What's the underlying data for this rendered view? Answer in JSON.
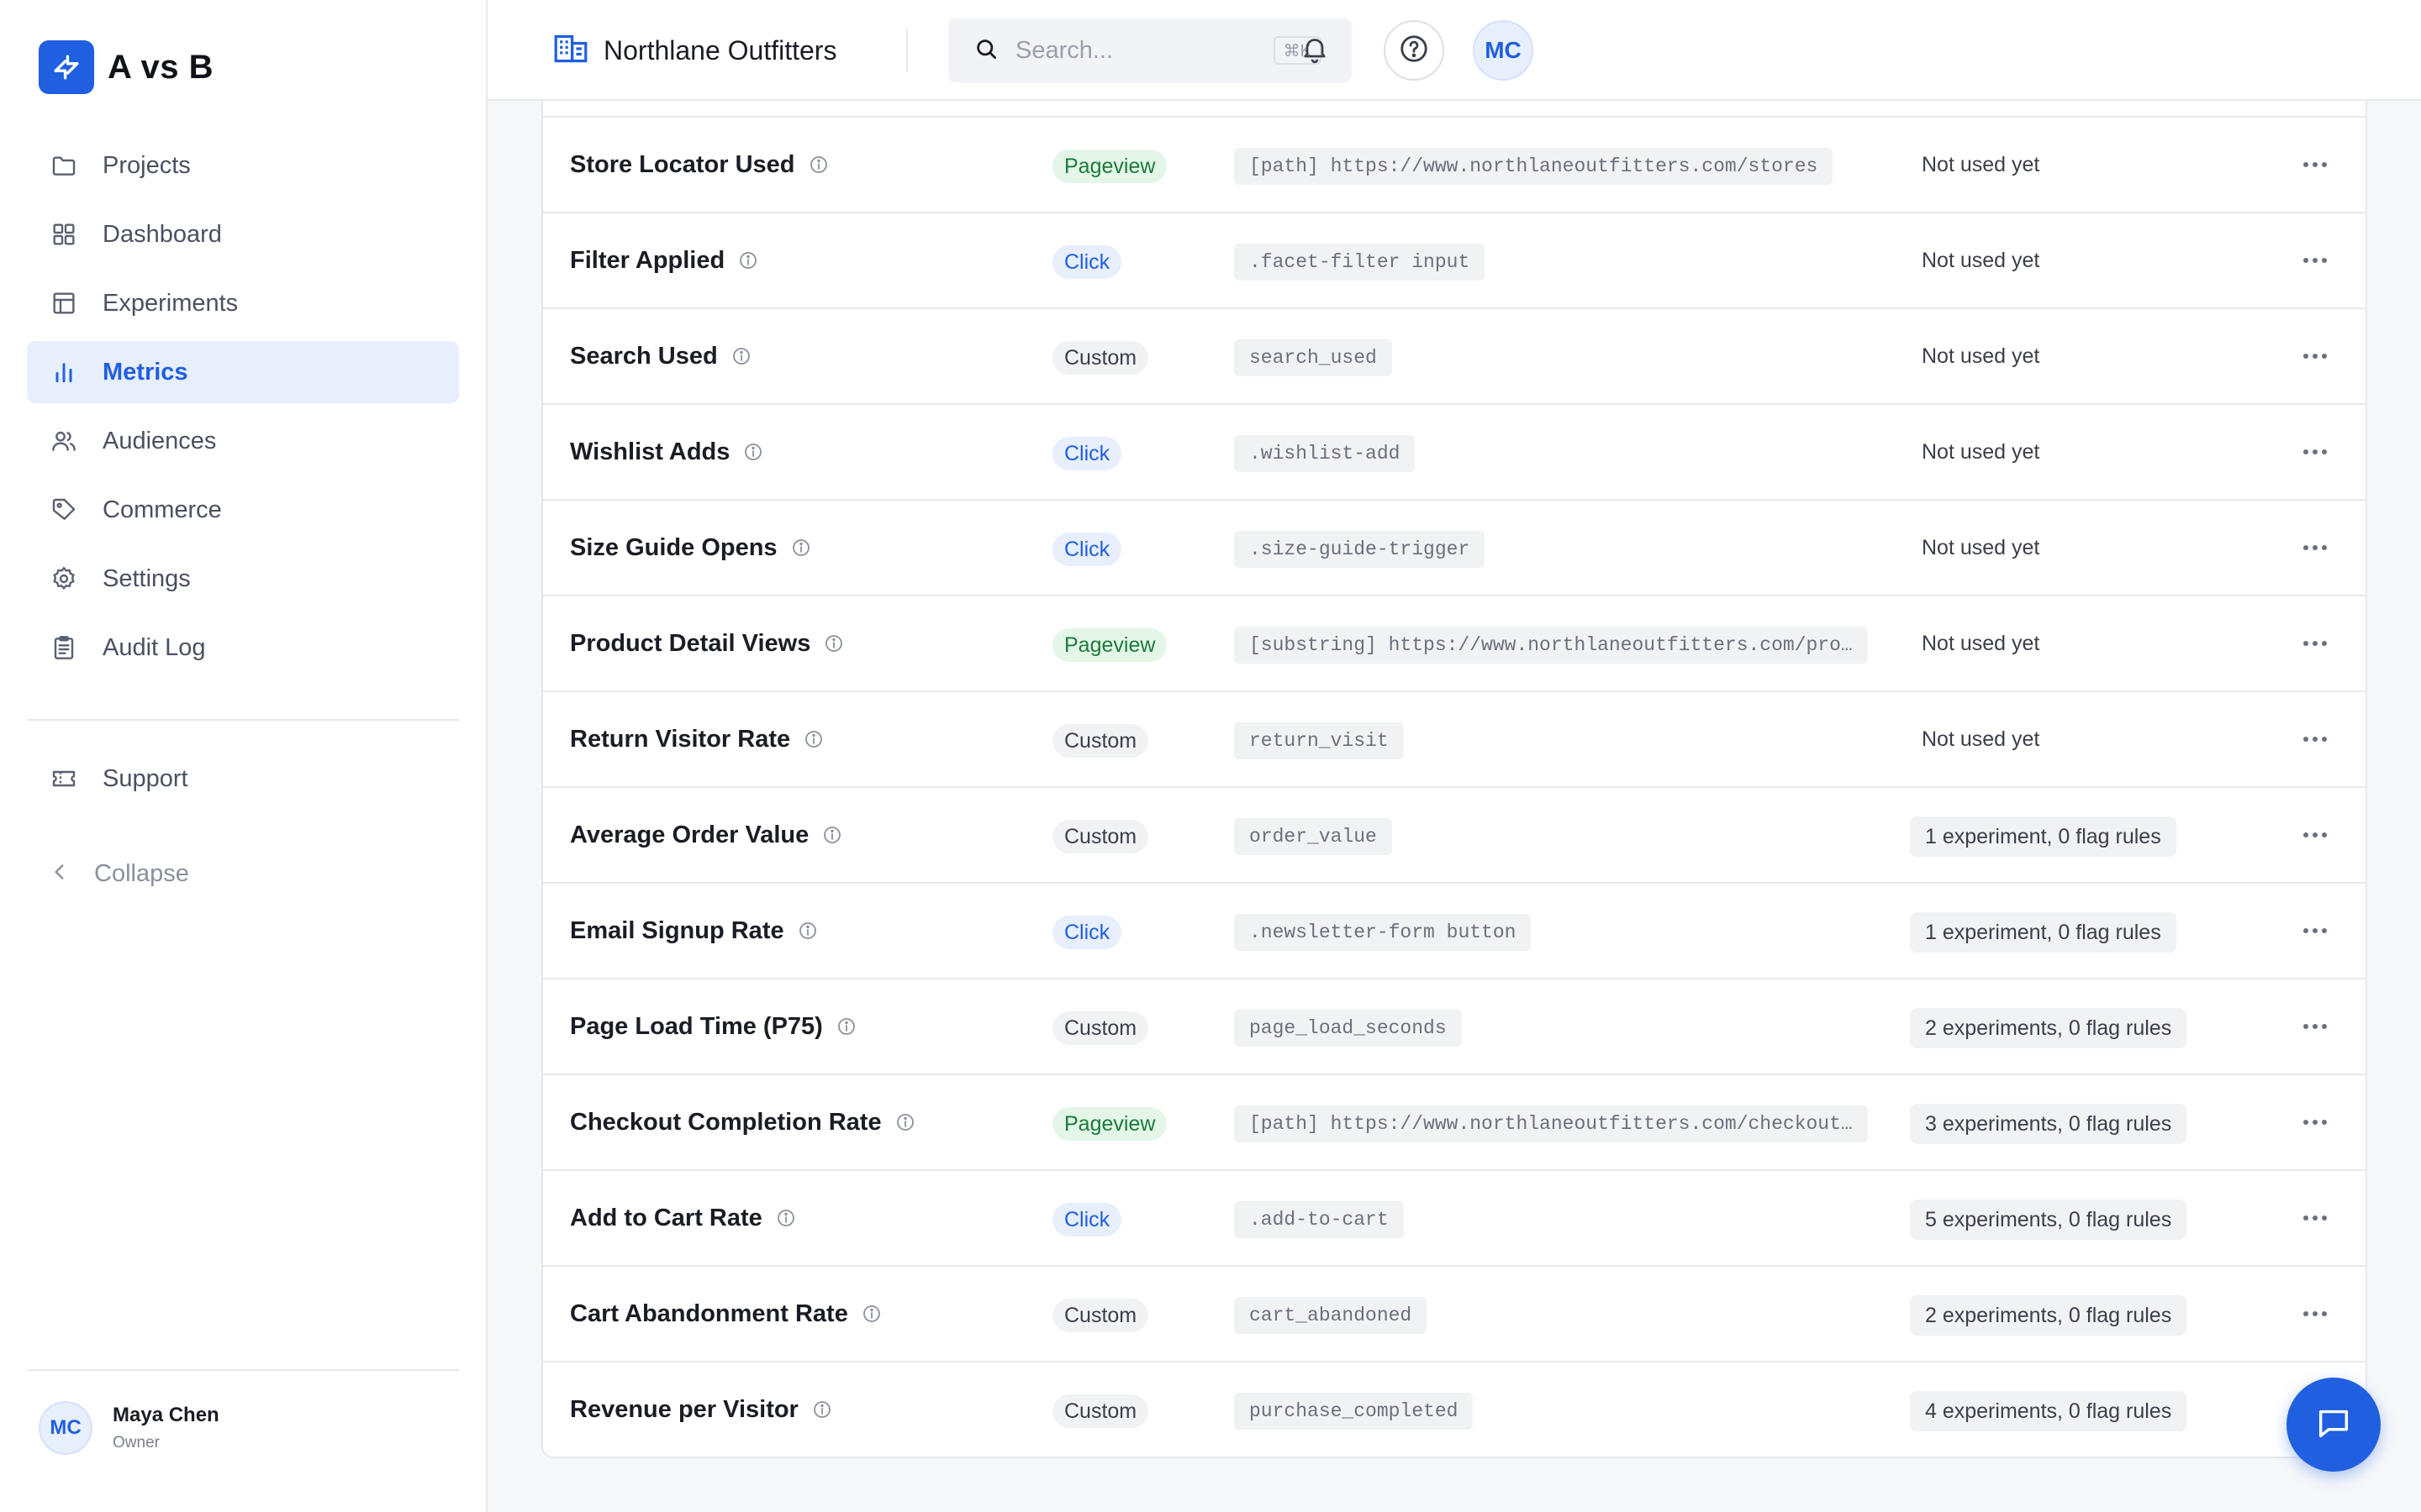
{
  "app": {
    "name": "A vs B",
    "org_name": "Northlane Outfitters"
  },
  "search": {
    "placeholder": "Search...",
    "shortcut": "⌘K"
  },
  "user": {
    "initials": "MC",
    "name": "Maya Chen",
    "role": "Owner"
  },
  "sidebar": {
    "items": [
      {
        "label": "Projects",
        "icon": "folder-icon",
        "active": false
      },
      {
        "label": "Dashboard",
        "icon": "grid-icon",
        "active": false
      },
      {
        "label": "Experiments",
        "icon": "table-icon",
        "active": false
      },
      {
        "label": "Metrics",
        "icon": "bar-chart-icon",
        "active": true
      },
      {
        "label": "Audiences",
        "icon": "users-icon",
        "active": false
      },
      {
        "label": "Commerce",
        "icon": "tag-icon",
        "active": false
      },
      {
        "label": "Settings",
        "icon": "gear-icon",
        "active": false
      },
      {
        "label": "Audit Log",
        "icon": "clipboard-icon",
        "active": false
      }
    ],
    "support_label": "Support",
    "collapse_label": "Collapse"
  },
  "colors": {
    "accent": "#1f5fe0",
    "pageview": "#1c7a3b",
    "active_bg": "#e7eefc"
  },
  "metrics": [
    {
      "name": "Store Locator Used",
      "type": "Pageview",
      "selector": "[path] https://www.northlaneoutfitters.com/stores",
      "usage": "Not used yet"
    },
    {
      "name": "Filter Applied",
      "type": "Click",
      "selector": ".facet-filter input",
      "usage": "Not used yet"
    },
    {
      "name": "Search Used",
      "type": "Custom",
      "selector": "search_used",
      "usage": "Not used yet"
    },
    {
      "name": "Wishlist Adds",
      "type": "Click",
      "selector": ".wishlist-add",
      "usage": "Not used yet"
    },
    {
      "name": "Size Guide Opens",
      "type": "Click",
      "selector": ".size-guide-trigger",
      "usage": "Not used yet"
    },
    {
      "name": "Product Detail Views",
      "type": "Pageview",
      "selector": "[substring] https://www.northlaneoutfitters.com/pro…",
      "usage": "Not used yet"
    },
    {
      "name": "Return Visitor Rate",
      "type": "Custom",
      "selector": "return_visit",
      "usage": "Not used yet"
    },
    {
      "name": "Average Order Value",
      "type": "Custom",
      "selector": "order_value",
      "usage": "1 experiment, 0 flag rules"
    },
    {
      "name": "Email Signup Rate",
      "type": "Click",
      "selector": ".newsletter-form button",
      "usage": "1 experiment, 0 flag rules"
    },
    {
      "name": "Page Load Time (P75)",
      "type": "Custom",
      "selector": "page_load_seconds",
      "usage": "2 experiments, 0 flag rules"
    },
    {
      "name": "Checkout Completion Rate",
      "type": "Pageview",
      "selector": "[path] https://www.northlaneoutfitters.com/checkout…",
      "usage": "3 experiments, 0 flag rules"
    },
    {
      "name": "Add to Cart Rate",
      "type": "Click",
      "selector": ".add-to-cart",
      "usage": "5 experiments, 0 flag rules"
    },
    {
      "name": "Cart Abandonment Rate",
      "type": "Custom",
      "selector": "cart_abandoned",
      "usage": "2 experiments, 0 flag rules"
    },
    {
      "name": "Revenue per Visitor",
      "type": "Custom",
      "selector": "purchase_completed",
      "usage": "4 experiments, 0 flag rules"
    }
  ]
}
